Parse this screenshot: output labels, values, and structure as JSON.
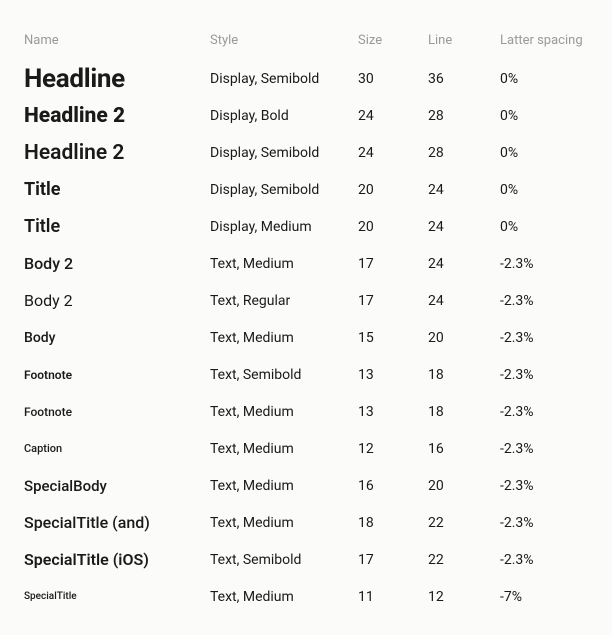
{
  "headers": {
    "name": "Name",
    "style": "Style",
    "size": "Size",
    "line": "Line",
    "spacing": "Latter spacing"
  },
  "rows": [
    {
      "name": "Headline",
      "style": "Display, Semibold",
      "size": "30",
      "line": "36",
      "spacing": "0%"
    },
    {
      "name": "Headline 2",
      "style": "Display, Bold",
      "size": "24",
      "line": "28",
      "spacing": "0%"
    },
    {
      "name": "Headline 2",
      "style": "Display, Semibold",
      "size": "24",
      "line": "28",
      "spacing": "0%"
    },
    {
      "name": "Title",
      "style": "Display, Semibold",
      "size": "20",
      "line": "24",
      "spacing": "0%"
    },
    {
      "name": "Title",
      "style": "Display, Medium",
      "size": "20",
      "line": "24",
      "spacing": "0%"
    },
    {
      "name": "Body 2",
      "style": "Text, Medium",
      "size": "17",
      "line": "24",
      "spacing": "-2.3%"
    },
    {
      "name": "Body 2",
      "style": "Text, Regular",
      "size": "17",
      "line": "24",
      "spacing": "-2.3%"
    },
    {
      "name": "Body",
      "style": "Text, Medium",
      "size": "15",
      "line": "20",
      "spacing": "-2.3%"
    },
    {
      "name": "Footnote",
      "style": "Text, Semibold",
      "size": "13",
      "line": "18",
      "spacing": "-2.3%"
    },
    {
      "name": "Footnote",
      "style": "Text, Medium",
      "size": "13",
      "line": "18",
      "spacing": "-2.3%"
    },
    {
      "name": "Caption",
      "style": "Text, Medium",
      "size": "12",
      "line": "16",
      "spacing": "-2.3%"
    },
    {
      "name": "SpecialBody",
      "style": "Text, Medium",
      "size": "16",
      "line": "20",
      "spacing": "-2.3%"
    },
    {
      "name": "SpecialTitle (and)",
      "style": "Text, Medium",
      "size": "18",
      "line": "22",
      "spacing": "-2.3%"
    },
    {
      "name": "SpecialTitle (iOS)",
      "style": "Text, Semibold",
      "size": "17",
      "line": "22",
      "spacing": "-2.3%"
    },
    {
      "name": "SpecialTitle",
      "style": "Text, Medium",
      "size": "11",
      "line": "12",
      "spacing": "-7%"
    }
  ]
}
